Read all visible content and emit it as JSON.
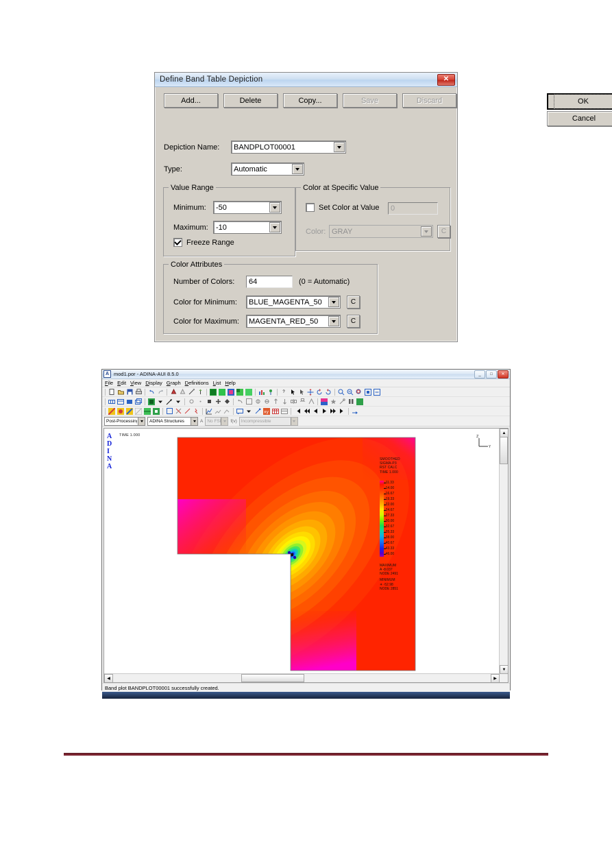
{
  "dialog": {
    "title": "Define Band Table Depiction",
    "close_icon": "close-icon",
    "buttons": {
      "add": "Add...",
      "delete": "Delete",
      "copy": "Copy...",
      "save": "Save",
      "discard": "Discard",
      "ok": "OK",
      "cancel": "Cancel"
    },
    "depiction_name_label": "Depiction Name:",
    "depiction_name_value": "BANDPLOT00001",
    "type_label": "Type:",
    "type_value": "Automatic",
    "value_range": {
      "legend": "Value Range",
      "minimum_label": "Minimum:",
      "minimum_value": "-50",
      "maximum_label": "Maximum:",
      "maximum_value": "-10",
      "freeze_range_label": "Freeze Range",
      "freeze_range_checked": true
    },
    "color_specific": {
      "legend": "Color at Specific Value",
      "set_color_label": "Set Color at Value",
      "set_color_checked": false,
      "value": "0",
      "color_label": "Color:",
      "color_value": "GRAY",
      "color_button": "C"
    },
    "color_attributes": {
      "legend": "Color Attributes",
      "number_of_colors_label": "Number of Colors:",
      "number_of_colors_value": "64",
      "automatic_hint": "(0 = Automatic)",
      "color_min_label": "Color for Minimum:",
      "color_min_value": "BLUE_MAGENTA_50",
      "color_min_button": "C",
      "color_max_label": "Color for Maximum:",
      "color_max_value": "MAGENTA_RED_50",
      "color_max_button": "C"
    }
  },
  "adina": {
    "window_title": "mod1.por - ADINA-AUI 8.5.0",
    "app_icon_letter": "A",
    "window_buttons": {
      "minimize": "_",
      "maximize": "□",
      "close": "✕"
    },
    "menu": [
      "File",
      "Edit",
      "View",
      "Display",
      "Graph",
      "Definitions",
      "List",
      "Help"
    ],
    "selection_bar": {
      "program": "Post-Processing",
      "module": "ADINA Structures",
      "a_label": "A",
      "no_fsi": "No FSI",
      "fsi_label": "f(v)",
      "flow": "Incompressible"
    },
    "status_text": "Band plot BANDPLOT00001 successfully created.",
    "plot": {
      "logo": [
        "A",
        "D",
        "I",
        "N",
        "A"
      ],
      "time_label": "TIME 1.000",
      "axis_labels": {
        "vertical": "Z",
        "horizontal": "Y"
      }
    }
  },
  "chart_data": {
    "type": "heatmap",
    "title": "SMOOTHED SIGMA-P3",
    "header_lines": [
      "SMOOTHED",
      "SIGMA-P3",
      "RST CALC",
      "TIME 1.000"
    ],
    "colorbar_label": "SMOOTHED SIGMA-P3",
    "tick_labels": [
      "-11.33",
      "-14.00",
      "-16.67",
      "-19.33",
      "-22.00",
      "-24.67",
      "-27.33",
      "-30.00",
      "-32.67",
      "-35.33",
      "-38.00",
      "-40.67",
      "-43.33",
      "-46.00",
      "-48.67"
    ],
    "tick_values": [
      -11.33,
      -14.0,
      -16.67,
      -19.33,
      -22.0,
      -24.67,
      -27.33,
      -30.0,
      -32.67,
      -35.33,
      -38.0,
      -40.67,
      -43.33,
      -46.0,
      -48.67
    ],
    "value_range": [
      -50,
      -10
    ],
    "number_of_colors": 64,
    "color_for_minimum": "BLUE_MAGENTA_50",
    "color_for_maximum": "MAGENTA_RED_50",
    "annotations": {
      "maximum_label": "MAXIMUM",
      "maximum_marker": "A",
      "maximum_value": "-8.037",
      "maximum_node_label": "NODE 2491",
      "minimum_label": "MINIMUM",
      "minimum_marker": "✳",
      "minimum_value": "-52.98",
      "minimum_node_label": "NODE 2851"
    },
    "geometry": "L-shaped plate, stress concentration at re-entrant corner",
    "grid": false,
    "legend_position": "right"
  }
}
